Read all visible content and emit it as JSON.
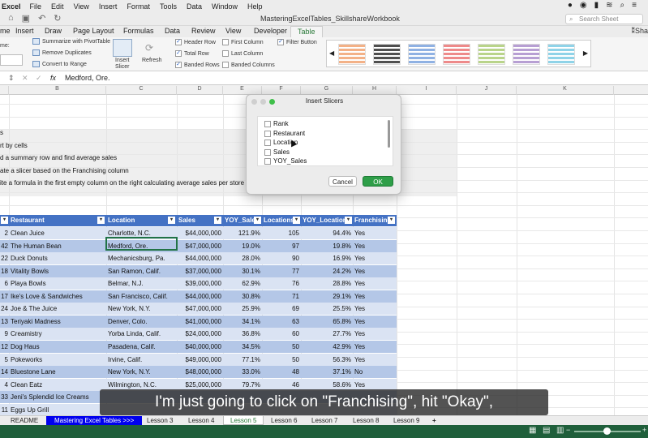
{
  "menubar": {
    "app": "Excel",
    "menus": [
      "File",
      "Edit",
      "View",
      "Insert",
      "Format",
      "Tools",
      "Data",
      "Window",
      "Help"
    ],
    "status_icons": [
      "record-icon",
      "shield-icon",
      "battery-icon",
      "wifi-icon",
      "search-icon",
      "menu-icon"
    ]
  },
  "titlebar": {
    "doc_title": "MasteringExcelTables_SkillshareWorkbook",
    "search_placeholder": "Search Sheet"
  },
  "ribbon_tabs": [
    "me",
    "Insert",
    "Draw",
    "Page Layout",
    "Formulas",
    "Data",
    "Review",
    "View",
    "Developer",
    "Table"
  ],
  "ribbon_active_tab": "Table",
  "share_label": "Sha",
  "ribbon": {
    "name_label": "me:",
    "summarize": "Summarize with PivotTable",
    "remove_dupes": "Remove Duplicates",
    "convert_range": "Convert to Range",
    "insert_slicer": [
      "Insert",
      "Slicer"
    ],
    "refresh": "Refresh",
    "options": [
      {
        "label": "Header Row",
        "checked": true
      },
      {
        "label": "Total Row",
        "checked": true
      },
      {
        "label": "Banded Rows",
        "checked": true
      },
      {
        "label": "First Column",
        "checked": false
      },
      {
        "label": "Last Column",
        "checked": false
      },
      {
        "label": "Banded Columns",
        "checked": false
      },
      {
        "label": "Filter Button",
        "checked": true
      }
    ],
    "style_colors": [
      "#f3b187",
      "#4f4f4f",
      "#8fb1e3",
      "#ee8a8a",
      "#b9d48a",
      "#b79fd3",
      "#8fd3e8"
    ]
  },
  "formula_bar": {
    "value": "Medford, Ore."
  },
  "columns": [
    "B",
    "C",
    "D",
    "E",
    "F",
    "G",
    "H",
    "I",
    "J",
    "K"
  ],
  "instructions": [
    "s",
    "rt by cells",
    "d a summary row and find average sales",
    "ate a slicer based on the Franchising column",
    "ite a formula in the first empty column on the right calculating average sales per store"
  ],
  "table": {
    "headers": [
      "Restaurant",
      "Location",
      "Sales",
      "YOY_Sales",
      "Locations",
      "YOY_Locations",
      "Franchising"
    ],
    "rows": [
      [
        "2",
        "Clean Juice",
        "Charlotte, N.C.",
        "$44,000,000",
        "121.9%",
        "105",
        "94.4%",
        "Yes"
      ],
      [
        "42",
        "The Human Bean",
        "Medford, Ore.",
        "$47,000,000",
        "19.0%",
        "97",
        "19.8%",
        "Yes"
      ],
      [
        "22",
        "Duck Donuts",
        "Mechanicsburg, Pa.",
        "$44,000,000",
        "28.0%",
        "90",
        "16.9%",
        "Yes"
      ],
      [
        "18",
        "Vitality Bowls",
        "San Ramon, Calif.",
        "$37,000,000",
        "30.1%",
        "77",
        "24.2%",
        "Yes"
      ],
      [
        "6",
        "Playa Bowls",
        "Belmar,  N.J.",
        "$39,000,000",
        "62.9%",
        "76",
        "28.8%",
        "Yes"
      ],
      [
        "17",
        "Ike's Love & Sandwiches",
        "San Francisco, Calif.",
        "$44,000,000",
        "30.8%",
        "71",
        "29.1%",
        "Yes"
      ],
      [
        "24",
        "Joe & The Juice",
        "New York, N.Y.",
        "$47,000,000",
        "25.9%",
        "69",
        "25.5%",
        "Yes"
      ],
      [
        "13",
        "Teriyaki Madness",
        "Denver, Colo.",
        "$41,000,000",
        "34.1%",
        "63",
        "65.8%",
        "Yes"
      ],
      [
        "9",
        "Creamistry",
        "Yorba Linda,  Calif.",
        "$24,000,000",
        "36.8%",
        "60",
        "27.7%",
        "Yes"
      ],
      [
        "12",
        "Dog Haus",
        "Pasadena, Calif.",
        "$40,000,000",
        "34.5%",
        "50",
        "42.9%",
        "Yes"
      ],
      [
        "5",
        "Pokeworks",
        "Irvine, Calif.",
        "$49,000,000",
        "77.1%",
        "50",
        "56.3%",
        "Yes"
      ],
      [
        "14",
        "Bluestone Lane",
        "New York, N.Y.",
        "$48,000,000",
        "33.0%",
        "48",
        "37.1%",
        "No"
      ],
      [
        "4",
        "Clean Eatz",
        "Wilmington, N.C.",
        "$25,000,000",
        "79.7%",
        "46",
        "58.6%",
        "Yes"
      ],
      [
        "33",
        "Jeni's Splendid Ice Creams",
        "",
        "",
        "",
        "",
        "",
        ""
      ],
      [
        "11",
        "Eggs Up Grill",
        "",
        "",
        "",
        "",
        "",
        ""
      ]
    ]
  },
  "dialog": {
    "title": "Insert Slicers",
    "fields": [
      "Rank",
      "Restaurant",
      "Location",
      "Sales",
      "YOY_Sales"
    ],
    "cancel": "Cancel",
    "ok": "OK"
  },
  "caption": "I'm just going to click on \"Franchising\", hit \"Okay\",",
  "sheets": [
    "README",
    "Mastering Excel Tables >>>",
    "Lesson 3",
    "Lesson 4",
    "Lesson 5",
    "Lesson 6",
    "Lesson 7",
    "Lesson 8",
    "Lesson 9"
  ],
  "active_sheet": "Lesson 5",
  "add_sheet": "+"
}
